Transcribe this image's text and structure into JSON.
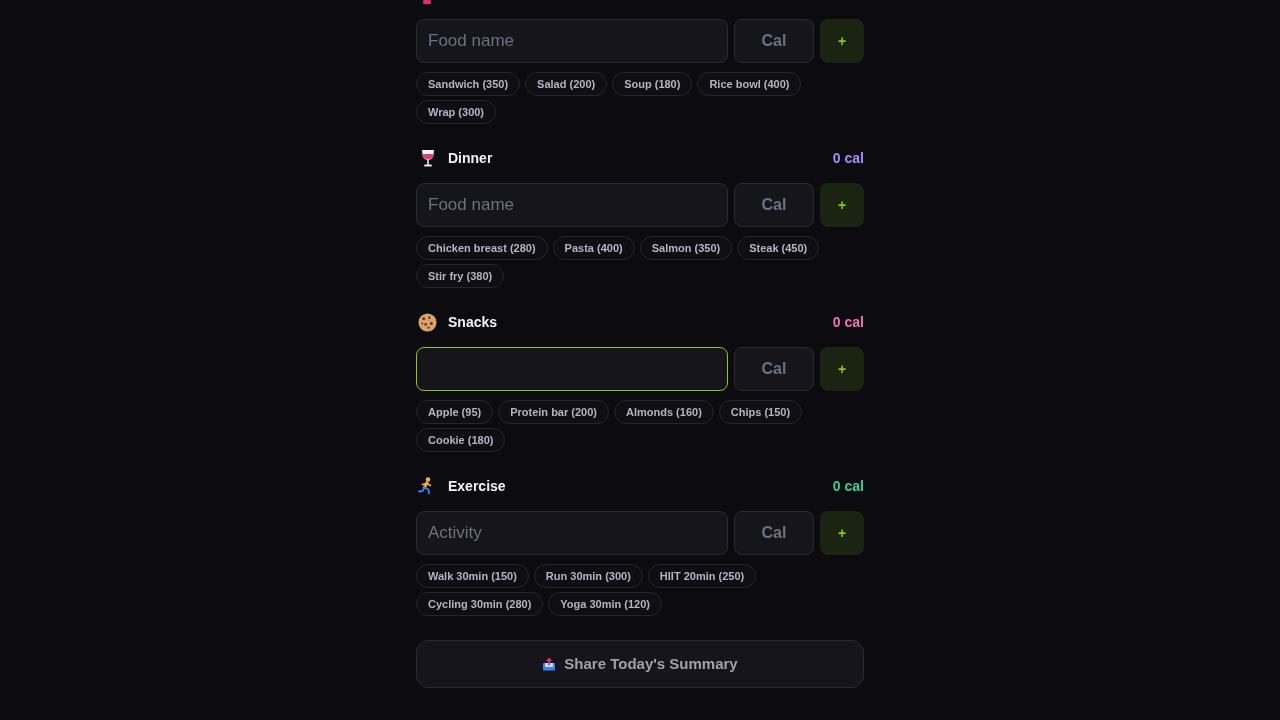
{
  "sections": [
    {
      "name_field": {
        "placeholder": "Food name",
        "focused": false
      },
      "calorie_field": {
        "placeholder": "Cal"
      },
      "add_button": "+",
      "chips": [
        "Sandwich (350)",
        "Salad (200)",
        "Soup (180)",
        "Rice bowl (400)",
        "Wrap (300)"
      ]
    },
    {
      "title": "Dinner",
      "total": "0 cal",
      "color": "#a78bfa",
      "name_field": {
        "placeholder": "Food name",
        "focused": false
      },
      "calorie_field": {
        "placeholder": "Cal"
      },
      "add_button": "+",
      "chips": [
        "Chicken breast (280)",
        "Pasta (400)",
        "Salmon (350)",
        "Steak (450)",
        "Stir fry (380)"
      ]
    },
    {
      "title": "Snacks",
      "total": "0 cal",
      "color": "#f472b6",
      "name_field": {
        "focused": true
      },
      "calorie_field": {
        "placeholder": "Cal"
      },
      "add_button": "+",
      "chips": [
        "Apple (95)",
        "Protein bar (200)",
        "Almonds (160)",
        "Chips (150)",
        "Cookie (180)"
      ]
    },
    {
      "title": "Exercise",
      "total": "0 cal",
      "color": "#34d399",
      "name_field": {
        "placeholder": "Activity",
        "focused": false
      },
      "calorie_field": {
        "placeholder": "Cal"
      },
      "add_button": "+",
      "chips": [
        "Walk 30min (150)",
        "Run 30min (300)",
        "HIIT 20min (250)",
        "Cycling 30min (280)",
        "Yoga 30min (120)"
      ]
    }
  ],
  "share_button": {
    "label": "Share Today's Summary"
  }
}
